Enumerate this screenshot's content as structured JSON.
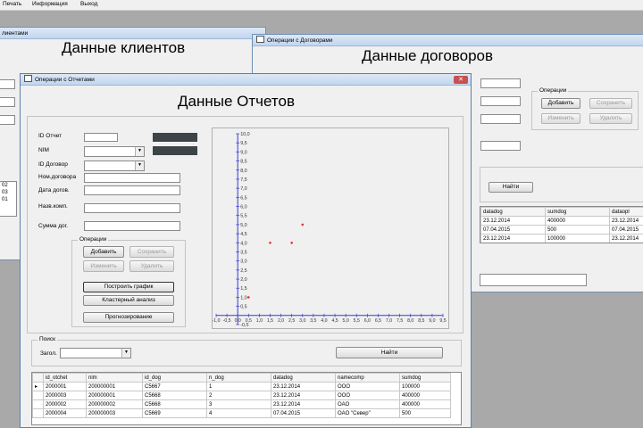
{
  "menu": {
    "items": [
      "Печать",
      "Информация",
      "Выход"
    ]
  },
  "clients_window": {
    "title_fragment": "лиентами",
    "heading": "Данные клиентов",
    "list_values": [
      "02",
      "03",
      "01"
    ]
  },
  "contracts_window": {
    "title": "Операции с Договорами",
    "heading": "Данные договоров",
    "ops_label": "Операции",
    "add": "Добавить",
    "save": "Сохранить",
    "edit": "Изменить",
    "delete": "Удалить",
    "find": "Найти",
    "table": {
      "columns": [
        "datadog",
        "sumdog",
        "dataopl"
      ],
      "rows": [
        [
          "23.12.2014",
          "400000",
          "23.12.2014"
        ],
        [
          "07.04.2015",
          "500",
          "07.04.2015"
        ],
        [
          "23.12.2014",
          "100000",
          "23.12.2014"
        ]
      ]
    }
  },
  "reports_window": {
    "title": "Операции с Отчетами",
    "heading": "Данные Отчетов",
    "close": "✕",
    "labels": {
      "id_report": "ID Отчет",
      "nim": "NIM",
      "id_contract": "ID Договор",
      "contract_no": "Ном.договора",
      "contract_date": "Дата догов.",
      "company_name": "Назв.комп.",
      "contract_sum": "Сумма дог."
    },
    "ops_label": "Операции",
    "add": "Добавить",
    "save": "Сохранить",
    "edit": "Изменить",
    "delete": "Удалить",
    "build_chart": "Построить график",
    "cluster": "Кластерный анализ",
    "forecast": "Прогнозирование",
    "search_label": "Поиск",
    "query_label": "Загол.",
    "find": "Найти",
    "table": {
      "columns": [
        "id_otchet",
        "nim",
        "id_dog",
        "n_dog",
        "datadog",
        "namecomp",
        "sumdog"
      ],
      "rows": [
        [
          "2000001",
          "200000001",
          "C5667",
          "1",
          "23.12.2014",
          "OOO",
          "100000"
        ],
        [
          "2000003",
          "200000001",
          "C5668",
          "2",
          "23.12.2014",
          "OOO",
          "400000"
        ],
        [
          "2000002",
          "200000002",
          "C5668",
          "3",
          "23.12.2014",
          "OAO",
          "400000"
        ],
        [
          "2000004",
          "200000003",
          "C5669",
          "4",
          "07.04.2015",
          "OAO \"Север\"",
          "500"
        ]
      ]
    }
  },
  "chart_data": {
    "type": "scatter",
    "x_ticks": [
      "-1,0",
      "-0,5",
      "0,0",
      "0,5",
      "1,0",
      "1,5",
      "2,0",
      "2,5",
      "3,0",
      "3,5",
      "4,0",
      "4,5",
      "5,0",
      "5,5",
      "6,0",
      "6,5",
      "7,0",
      "7,5",
      "8,0",
      "8,5",
      "9,0",
      "9,5"
    ],
    "y_ticks": [
      "10,0",
      "9,5",
      "9,0",
      "8,5",
      "8,0",
      "7,5",
      "7,0",
      "6,5",
      "6,0",
      "5,5",
      "5,0",
      "4,5",
      "4,0",
      "3,5",
      "3,0",
      "2,5",
      "2,0",
      "1,5",
      "1,0",
      "0,5",
      "-0,5"
    ],
    "xlim": [
      -1.0,
      9.5
    ],
    "ylim": [
      -0.5,
      10.0
    ],
    "points": [
      {
        "x": 0.5,
        "y": 1.0
      },
      {
        "x": 1.5,
        "y": 4.0
      },
      {
        "x": 2.5,
        "y": 4.0
      },
      {
        "x": 3.0,
        "y": 5.0
      }
    ],
    "point_color": "#e0303a",
    "axis_color": "#3a3ad0",
    "grid": false
  }
}
